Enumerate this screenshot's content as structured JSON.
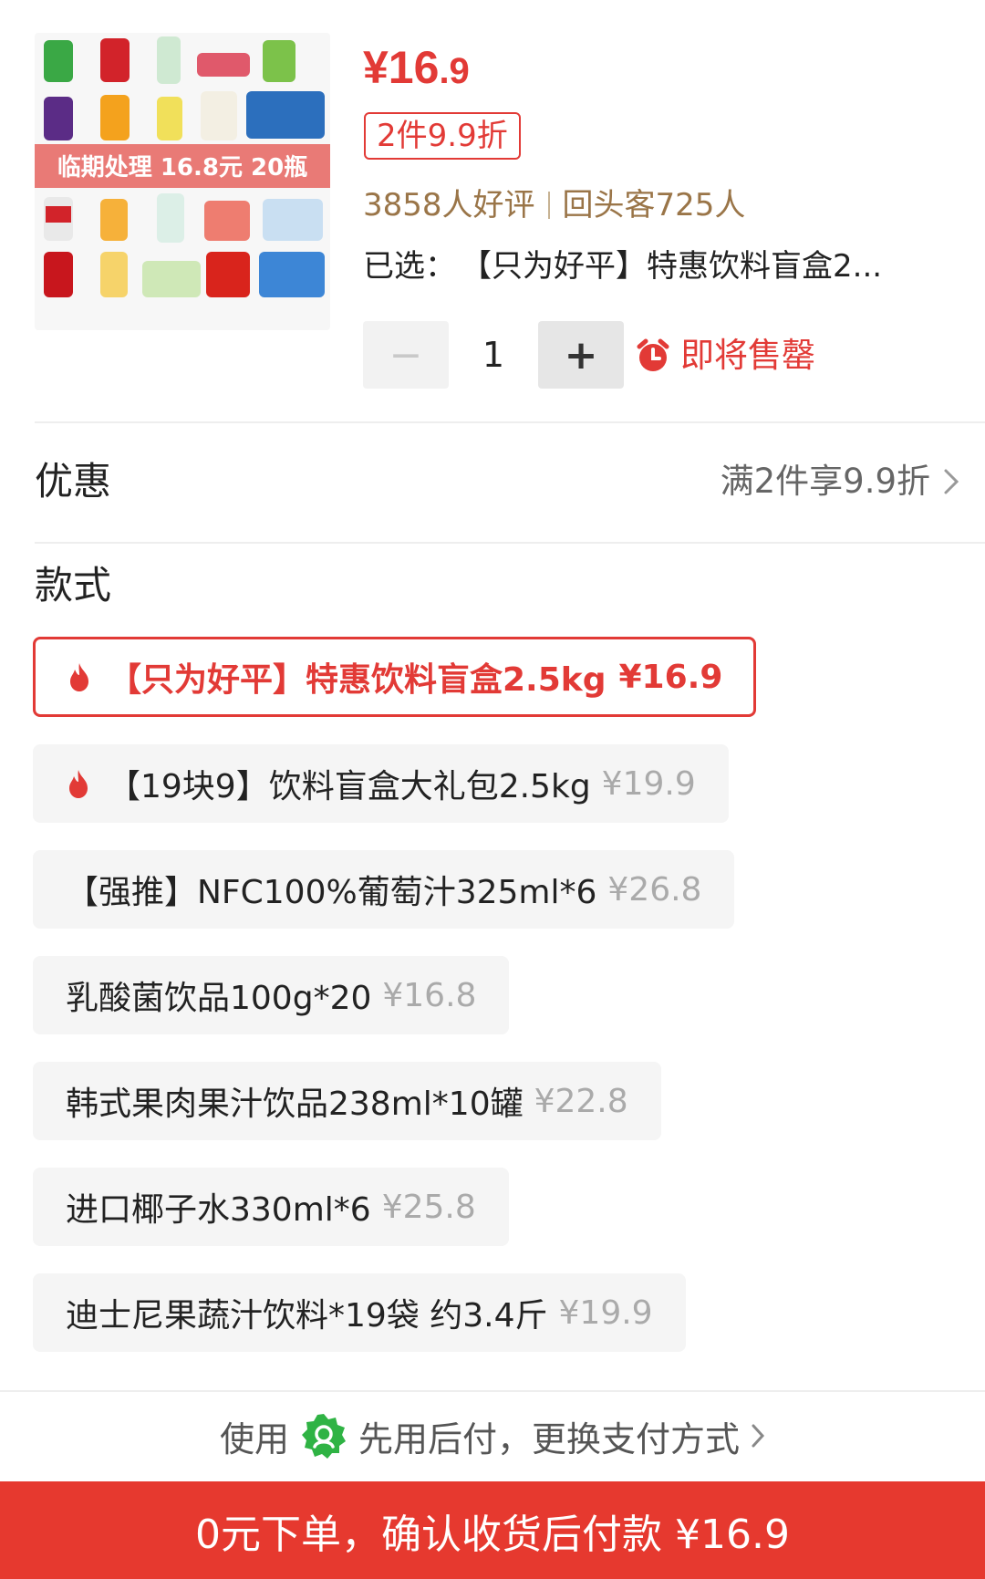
{
  "product": {
    "image_caption": "临期处理 16.8元 20瓶",
    "price_main": "¥16",
    "price_cents": ".9",
    "promo_badge": "2件9.9折",
    "reviews": "3858人好评",
    "repeat_buyers": "回头客725人",
    "selected_label": "已选：",
    "selected_value": "【只为好平】特惠饮料盲盒2...",
    "quantity": "1",
    "qty_minus": "−",
    "qty_plus": "+",
    "stock_status": "即将售罄"
  },
  "discount": {
    "label": "优惠",
    "value": "满2件享9.9折"
  },
  "styles": {
    "title": "款式",
    "options": [
      {
        "name": "【只为好平】特惠饮料盲盒2.5kg",
        "price": "¥16.9",
        "selected": true,
        "hot": true
      },
      {
        "name": "【19块9】饮料盲盒大礼包2.5kg",
        "price": "¥19.9",
        "selected": false,
        "hot": true
      },
      {
        "name": "【强推】NFC100%葡萄汁325ml*6",
        "price": "¥26.8",
        "selected": false,
        "hot": false
      },
      {
        "name": "乳酸菌饮品100g*20",
        "price": "¥16.8",
        "selected": false,
        "hot": false
      },
      {
        "name": "韩式果肉果汁饮品238ml*10罐",
        "price": "¥22.8",
        "selected": false,
        "hot": false
      },
      {
        "name": "进口椰子水330ml*6",
        "price": "¥25.8",
        "selected": false,
        "hot": false
      },
      {
        "name": "迪士尼果蔬汁饮料*19袋 约3.4斤",
        "price": "¥19.9",
        "selected": false,
        "hot": false
      }
    ]
  },
  "payment": {
    "prefix": "使用",
    "method": "先用后付，更换支付方式"
  },
  "cta": {
    "label": "0元下单，确认收货后付款 ¥16.9"
  },
  "colors": {
    "accent": "#e23a36",
    "cta_bg": "#e6392f",
    "stats_text": "#9a7548",
    "pay_badge": "#2fb344"
  }
}
